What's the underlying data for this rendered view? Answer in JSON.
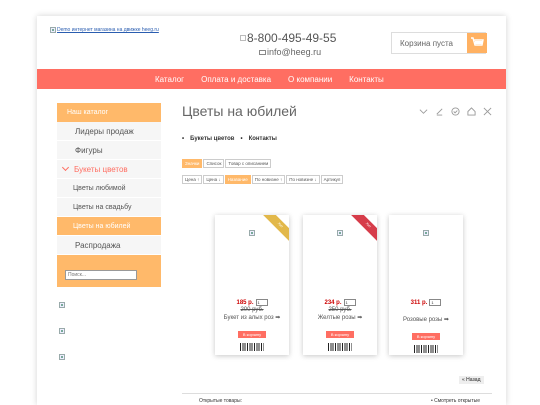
{
  "header": {
    "logo_alt": "Demo интернет магазина на движке heeg.ru",
    "phone": "8-800-495-49-55",
    "email": "info@heeg.ru",
    "cart_label": "Корзина пуста"
  },
  "nav": [
    "Каталог",
    "Оплата и доставка",
    "О компании",
    "Контакты"
  ],
  "sidebar": {
    "heading": "Наш каталог",
    "items": [
      {
        "label": "Лидеры продаж"
      },
      {
        "label": "Фигуры"
      },
      {
        "label": "Букеты цветов"
      },
      {
        "label": "Цветы любимой"
      },
      {
        "label": "Цветы на свадьбу"
      },
      {
        "label": "Цветы на юбилей"
      },
      {
        "label": "Распродажа"
      }
    ],
    "search_placeholder": "Поиск..."
  },
  "main": {
    "title": "Цветы на юбилей",
    "subcats": [
      "Букеты цветов",
      "Контакты"
    ],
    "view_tabs": [
      "Значки",
      "Список",
      "Товар с описанием"
    ],
    "sort_tabs": [
      "Цена ↑",
      "Цена ↓",
      "Название",
      "По новизне ↑",
      "По новизне ↓",
      "Артикул"
    ],
    "products": [
      {
        "price": "185 р.",
        "old_price": "200 руб.",
        "name": "Букет из алых роз",
        "ribbon": "Хит",
        "ribbon_color": "#e2b84a",
        "buy": "В корзину"
      },
      {
        "price": "234 р.",
        "old_price": "250 руб.",
        "name": "Желтые розы",
        "ribbon": "Хит",
        "ribbon_color": "#d63c4a",
        "buy": "В корзину"
      },
      {
        "price": "311 р.",
        "old_price": "",
        "name": "Розовые розы",
        "ribbon": "",
        "ribbon_color": "",
        "buy": "В корзину"
      }
    ],
    "back_label": "Назад",
    "viewed_label": "Открытые товары:",
    "viewed_link": "Смотреть открытые"
  },
  "colors": {
    "accent": "#ff6e62",
    "secondary": "#ffb96a"
  }
}
